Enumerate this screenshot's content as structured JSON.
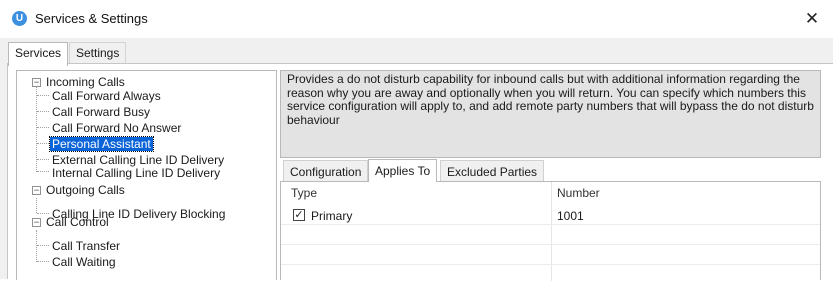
{
  "window": {
    "title": "Services & Settings",
    "icon_letter": "U",
    "close_glyph": "✕"
  },
  "outer_tabs": [
    {
      "label": "Services",
      "active": true
    },
    {
      "label": "Settings",
      "active": false
    }
  ],
  "tree": {
    "groups": [
      {
        "label": "Incoming Calls",
        "expander": "−"
      },
      {
        "label": "Outgoing Calls",
        "expander": "−"
      },
      {
        "label": "Call Control",
        "expander": "−"
      }
    ],
    "items": [
      {
        "label": "Call Forward Always"
      },
      {
        "label": "Call Forward Busy"
      },
      {
        "label": "Call Forward No Answer"
      },
      {
        "label": "Personal Assistant",
        "selected": true
      },
      {
        "label": "External Calling Line ID Delivery"
      },
      {
        "label": "Internal Calling Line ID Delivery"
      },
      {
        "label": "Calling Line ID Delivery Blocking"
      },
      {
        "label": "Call Transfer"
      },
      {
        "label": "Call Waiting"
      }
    ]
  },
  "description": "Provides a do not disturb capability for inbound calls but with additional information regarding the reason why you are away and optionally when you will return. You can specify which numbers this service configuration will apply to, and add remote party numbers that will bypass the do not disturb behaviour",
  "inner_tabs": [
    {
      "label": "Configuration",
      "active": false
    },
    {
      "label": "Applies To",
      "active": true
    },
    {
      "label": "Excluded Parties",
      "active": false
    }
  ],
  "grid": {
    "columns": [
      "Type",
      "Number"
    ],
    "rows": [
      {
        "checked": true,
        "check_glyph": "✓",
        "type": "Primary",
        "number": "1001"
      }
    ]
  }
}
